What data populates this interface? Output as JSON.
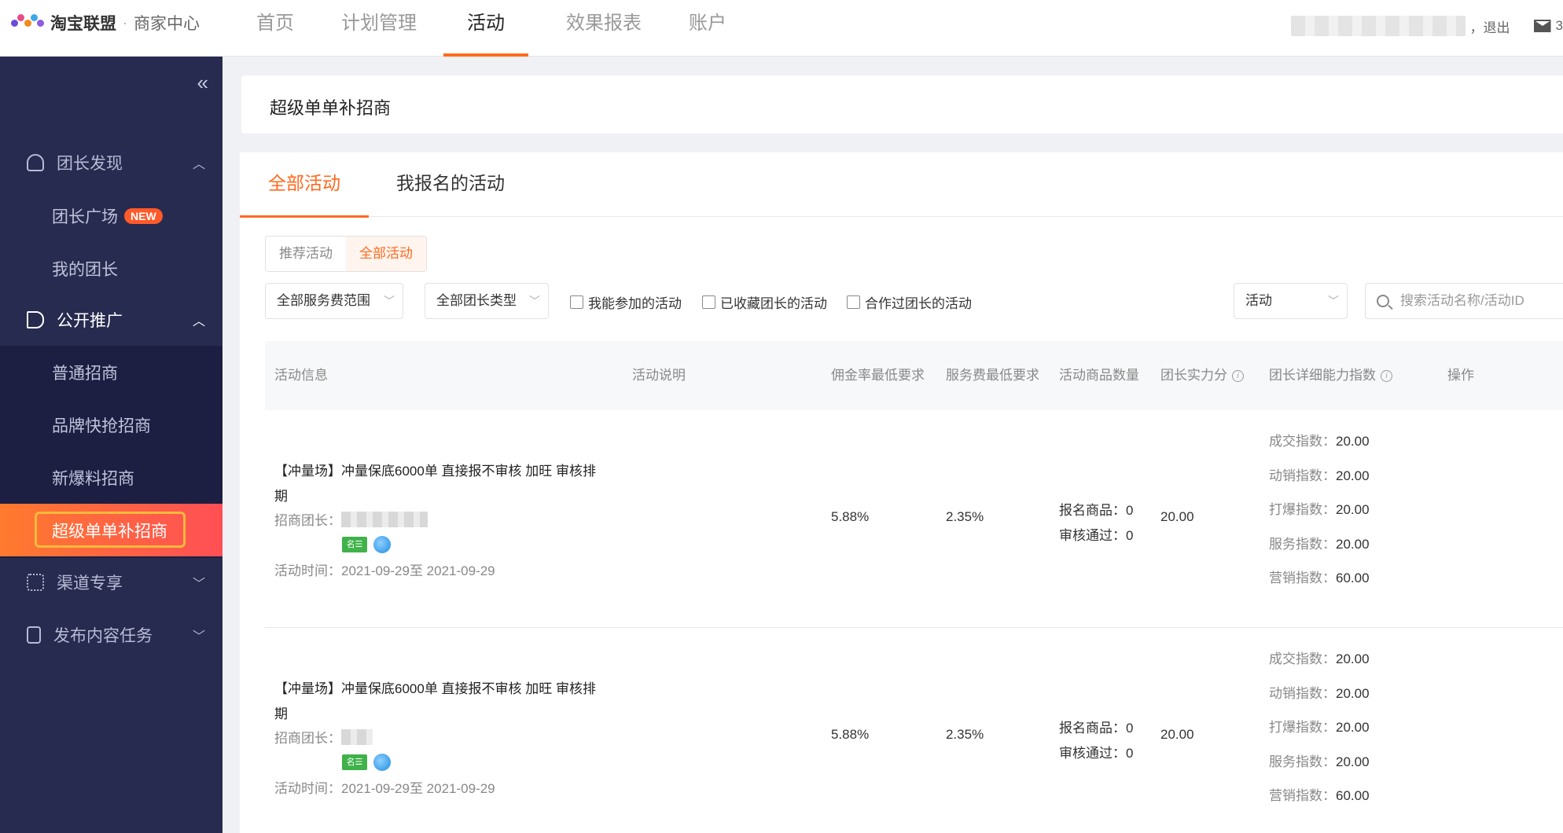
{
  "header": {
    "brand": "淘宝联盟",
    "separator": "·",
    "sub": "商家中心",
    "nav": [
      "首页",
      "计划管理",
      "活动",
      "效果报表",
      "账户"
    ],
    "active_nav": "活动",
    "logout": "，退出",
    "mail_count": "3"
  },
  "sidebar": {
    "collapse_icon": "double-chevron-left",
    "groups": [
      {
        "label": "团长发现",
        "icon": "user-icon",
        "open": false
      },
      {
        "label": "公开推广",
        "icon": "megaphone-icon",
        "open": true
      },
      {
        "label": "渠道专享",
        "icon": "org-chart-icon",
        "open": false
      },
      {
        "label": "发布内容任务",
        "icon": "document-icon",
        "open": false
      }
    ],
    "items": {
      "leader_square": "团长广场",
      "new_badge": "NEW",
      "my_leader": "我的团长",
      "normal": "普通招商",
      "brand_flash": "品牌快抢招商",
      "new_hot": "新爆料招商",
      "super_single": "超级单单补招商"
    }
  },
  "page": {
    "title": "超级单单补招商",
    "tabs": [
      "全部活动",
      "我报名的活动"
    ],
    "active_tab": "全部活动"
  },
  "filters": {
    "segments": [
      "推荐活动",
      "全部活动"
    ],
    "active_segment": "全部活动",
    "service_fee": "全部服务费范围",
    "leader_type": "全部团长类型",
    "checks": [
      "我能参加的活动",
      "已收藏团长的活动",
      "合作过团长的活动"
    ],
    "search_type": "活动",
    "search_placeholder": "搜索活动名称/活动ID"
  },
  "table": {
    "headers": [
      "活动信息",
      "活动说明",
      "佣金率最低要求",
      "服务费最低要求",
      "活动商品数量",
      "团长实力分",
      "团长详细能力指数",
      "操作"
    ],
    "rows": [
      {
        "name": "【冲量场】冲量保底6000单 直接报不审核 加旺 审核排期",
        "leader_label": "招商团长：",
        "leader_icon_text": "名☰",
        "time": "活动时间：2021-09-29至 2021-09-29",
        "commission": "5.88%",
        "service_fee": "2.35%",
        "goods": [
          "报名商品：0",
          "审核通过：0"
        ],
        "strength": "20.00",
        "ability": [
          {
            "label": "成交指数：",
            "value": "20.00"
          },
          {
            "label": "动销指数：",
            "value": "20.00"
          },
          {
            "label": "打爆指数：",
            "value": "20.00"
          },
          {
            "label": "服务指数：",
            "value": "20.00"
          },
          {
            "label": "营销指数：",
            "value": "60.00"
          }
        ]
      },
      {
        "name": "【冲量场】冲量保底6000单 直接报不审核 加旺 审核排期",
        "leader_label": "招商团长：",
        "leader_icon_text": "名☰",
        "time": "活动时间：2021-09-29至 2021-09-29",
        "commission": "5.88%",
        "service_fee": "2.35%",
        "goods": [
          "报名商品：0",
          "审核通过：0"
        ],
        "strength": "20.00",
        "ability": [
          {
            "label": "成交指数：",
            "value": "20.00"
          },
          {
            "label": "动销指数：",
            "value": "20.00"
          },
          {
            "label": "打爆指数：",
            "value": "20.00"
          },
          {
            "label": "服务指数：",
            "value": "20.00"
          },
          {
            "label": "营销指数：",
            "value": "60.00"
          }
        ]
      }
    ]
  },
  "colors": {
    "accent": "#ff6a1f",
    "sidebar_bg": "#272b4f",
    "sidebar_sub_bg": "#1c1f42",
    "active_gradient_start": "#ff7a2e",
    "active_gradient_end": "#ff4f55",
    "highlight_border": "#f7b93c"
  }
}
